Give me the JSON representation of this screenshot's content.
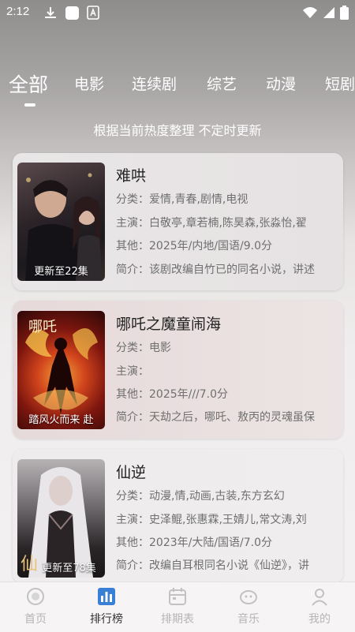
{
  "status_bar": {
    "time": "2:12"
  },
  "tabs": [
    {
      "label": "全部",
      "active": true
    },
    {
      "label": "电影"
    },
    {
      "label": "连续剧"
    },
    {
      "label": "综艺"
    },
    {
      "label": "动漫"
    },
    {
      "label": "短剧"
    }
  ],
  "subtitle": "根据当前热度整理 不定时更新",
  "cards": [
    {
      "title": "难哄",
      "badge": "更新至22集",
      "category": "分类：爱情,青春,剧情,电视",
      "cast": "主演：白敬亭,章若楠,陈昊森,张淼怡,翟",
      "other": "其他：2025年/内地/国语/9.0分",
      "intro": "简介：该剧改编自竹已的同名小说，讲述"
    },
    {
      "title": "哪吒之魔童闹海",
      "badge": "踏风火而来 赴",
      "category": "分类：电影",
      "cast": "主演：",
      "other": "其他：2025年///7.0分",
      "intro": "简介：天劫之后，哪吒、敖丙的灵魂虽保"
    },
    {
      "title": "仙逆",
      "badge": "更新至78集",
      "category": "分类：动漫,情,动画,古装,东方玄幻",
      "cast": "主演：史泽鲲,张惠霖,王婧儿,常文涛,刘",
      "other": "其他：2023年/大陆/国语/7.0分",
      "intro": "简介：改编自耳根同名小说《仙逆》，讲"
    }
  ],
  "bottom_nav": [
    {
      "label": "首页",
      "icon": "home-icon"
    },
    {
      "label": "排行榜",
      "icon": "ranking-icon",
      "active": true
    },
    {
      "label": "排期表",
      "icon": "calendar-icon"
    },
    {
      "label": "音乐",
      "icon": "music-icon"
    },
    {
      "label": "我的",
      "icon": "profile-icon"
    }
  ],
  "colors": {
    "accent": "#333333",
    "inactive": "#b5b5b5",
    "ranking_icon": "#3a7fd6"
  }
}
